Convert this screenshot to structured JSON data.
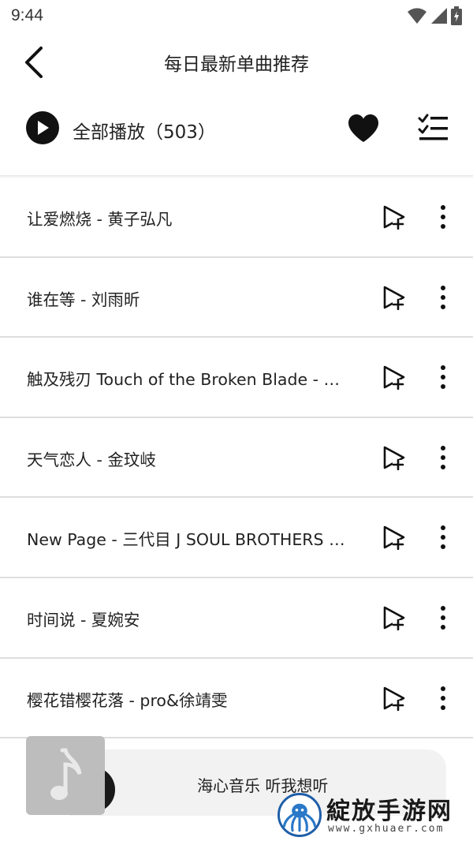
{
  "status_bar": {
    "time": "9:44",
    "icons": [
      "wifi-icon",
      "signal-icon",
      "battery-icon"
    ]
  },
  "header": {
    "back_icon": "back-arrow-icon",
    "title": "每日最新单曲推荐"
  },
  "play_bar": {
    "play_all_label": "全部播放（503）",
    "icons": [
      "play-circle-icon",
      "heart-icon",
      "checklist-icon"
    ]
  },
  "songs": [
    {
      "title": "让爱燃烧 - 黄子弘凡"
    },
    {
      "title": "谁在等 - 刘雨昕"
    },
    {
      "title": "触及残刃 Touch of the Broken Blade - HO…"
    },
    {
      "title": "天气恋人 - 金玟岐"
    },
    {
      "title": "New Page - 三代目 J SOUL BROTHERS fr…"
    },
    {
      "title": "时间说 - 夏婉安"
    },
    {
      "title": "樱花错樱花落 - pro&徐靖雯"
    }
  ],
  "row_icons": [
    "add-to-playlist-icon",
    "more-vertical-icon"
  ],
  "mini_player": {
    "text": "海心音乐 听我想听",
    "album_icon": "music-note-icon"
  },
  "watermark": {
    "name": "綻放手游网",
    "url": "www.gxhuaer.com"
  },
  "colors": {
    "primary_text": "#222222",
    "divider": "#dedede",
    "mini_player_bg": "#f2f2f2",
    "watermark_blue": "#1f5fa8"
  }
}
